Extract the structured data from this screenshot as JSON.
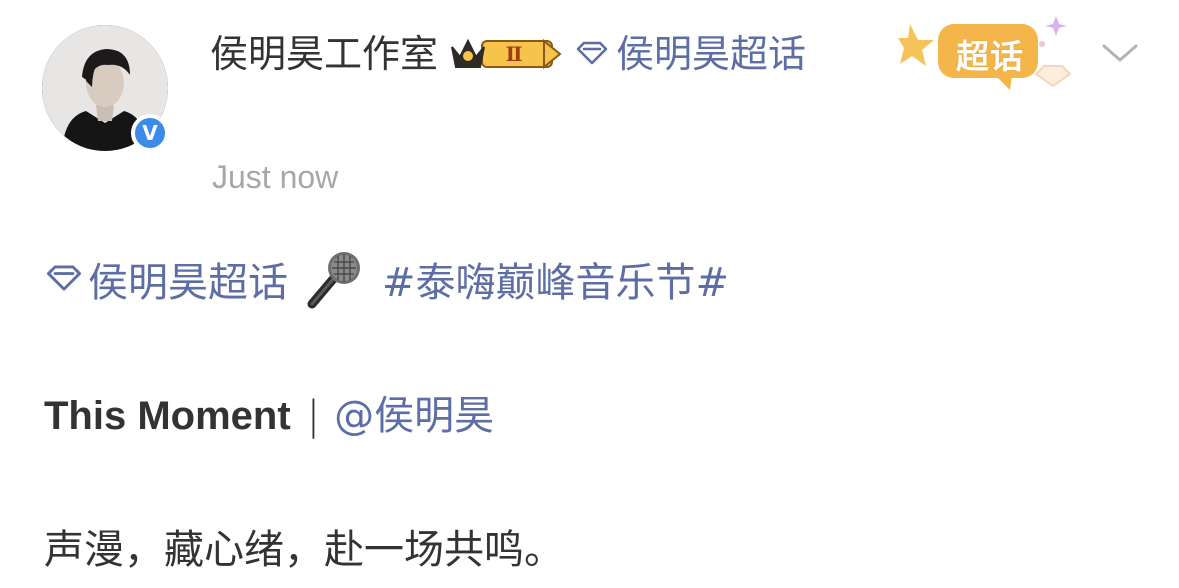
{
  "post": {
    "author_name": "侯明昊工作室",
    "header_topic_label": "侯明昊超话",
    "timestamp": "Just now",
    "badge_level": "Ⅱ",
    "super_badge_label": "超话"
  },
  "content": {
    "topic_label": "侯明昊超话",
    "hashtag": "#泰嗨巅峰音乐节#",
    "song_title": "This Moment",
    "separator": "|",
    "mention": "@侯明昊",
    "caption": "声漫，藏心绪，赴一场共鸣。"
  },
  "colors": {
    "link": "#5d6ea6",
    "text": "#333333",
    "timestamp": "#a7a7a7",
    "verified": "#3d8be8",
    "badge_gold": "#f2b33d"
  },
  "icons": {
    "verified": "verified-v-icon",
    "crown": "crown-level-icon",
    "diamond": "supertopic-diamond-icon",
    "mic": "microphone-emoji",
    "chevron": "chevron-down-icon"
  }
}
